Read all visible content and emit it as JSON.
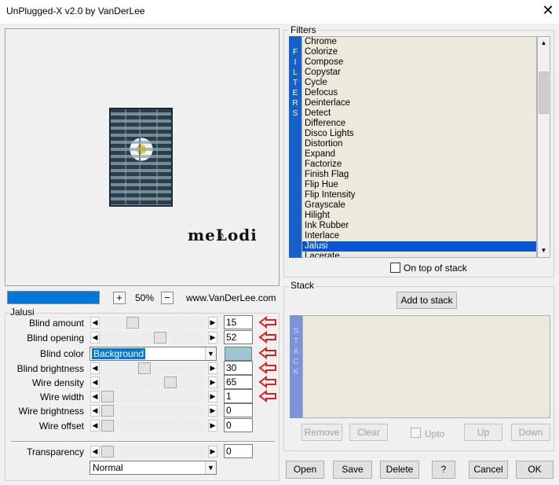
{
  "window": {
    "title": "UnPlugged-X v2.0 by VanDerLee",
    "close_glyph": "✕"
  },
  "preview": {
    "logo_text": "meLodi",
    "logo_note": "♪"
  },
  "zoom": {
    "progress_percent": 100,
    "plus": "+",
    "value": "50%",
    "minus": "−",
    "website": "www.VanDerLee.com"
  },
  "filter_panel": {
    "title": "Jalusi",
    "params": [
      {
        "label": "Blind amount",
        "value": "15",
        "thumb_fraction": 0.27
      },
      {
        "label": "Blind opening",
        "value": "52",
        "thumb_fraction": 0.57
      },
      {
        "label": "Blind color",
        "select_value": "Background",
        "swatch_color": "#9dc6d3"
      },
      {
        "label": "Blind brightness",
        "value": "30",
        "thumb_fraction": 0.4
      },
      {
        "label": "Wire density",
        "value": "65",
        "thumb_fraction": 0.68
      },
      {
        "label": "Wire width",
        "value": "1",
        "thumb_fraction": 0.0
      },
      {
        "label": "Wire brightness",
        "value": "0",
        "thumb_fraction": 0.0
      },
      {
        "label": "Wire offset",
        "value": "0",
        "thumb_fraction": 0.0
      }
    ],
    "transparency": {
      "label": "Transparency",
      "value": "0",
      "thumb_fraction": 0.0
    },
    "blend_mode": "Normal",
    "arrow_color": "#e02020"
  },
  "filters": {
    "title": "Filters",
    "bar_letters": [
      "F",
      "I",
      "L",
      "T",
      "E",
      "R",
      "S"
    ],
    "items": [
      "Chrome",
      "Colorize",
      "Compose",
      "Copystar",
      "Cycle",
      "Defocus",
      "Deinterlace",
      "Detect",
      "Difference",
      "Disco Lights",
      "Distortion",
      "Expand",
      "Factorize",
      "Finish Flag",
      "Flip Hue",
      "Flip Intensity",
      "Grayscale",
      "Hilight",
      "Ink Rubber",
      "Interlace",
      "Jalusi",
      "Lacerate"
    ],
    "selected": "Jalusi",
    "ontop_label": "On top of stack"
  },
  "stack": {
    "title": "Stack",
    "add_label": "Add to stack",
    "bar_letters": [
      "S",
      "T",
      "A",
      "C",
      "K"
    ],
    "remove_label": "Remove",
    "clear_label": "Clear",
    "upto_label": "Upto",
    "up_label": "Up",
    "down_label": "Down"
  },
  "buttons": {
    "open": "Open",
    "save": "Save",
    "delete": "Delete",
    "help": "?",
    "cancel": "Cancel",
    "ok": "OK"
  },
  "colors": {
    "accent": "#0078d7",
    "filters_bar": "#1560c9",
    "stack_bar": "#7b93d8",
    "list_bg": "#ede9dc",
    "selection": "#0a54d6"
  }
}
